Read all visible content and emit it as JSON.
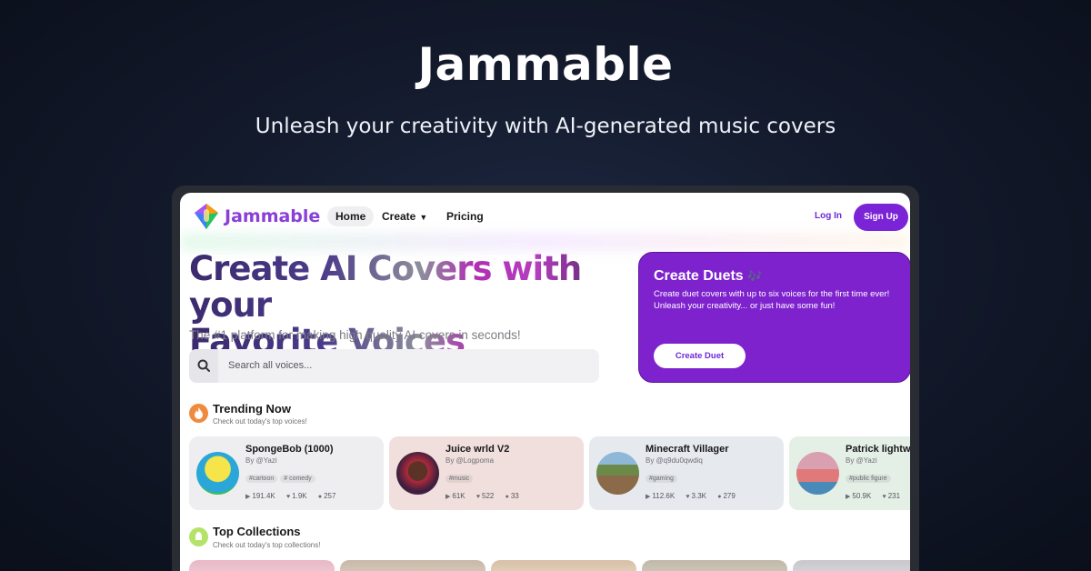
{
  "promo": {
    "title": "Jammable",
    "subtitle": "Unleash your creativity with AI-generated music covers"
  },
  "nav": {
    "logo_text": "Jammable",
    "home": "Home",
    "create": "Create",
    "pricing": "Pricing",
    "login": "Log In",
    "signup": "Sign Up"
  },
  "hero": {
    "headline_line1": "Create AI Covers with your",
    "headline_line2": "Favorite Voices",
    "subheadline": "The #1 platform for making high quality AI covers in seconds!",
    "search_placeholder": "Search all voices..."
  },
  "duet": {
    "title": "Create Duets",
    "notes": "🎶",
    "description": "Create duet covers with up to six voices for the first time ever! Unleash your creativity... or just have some fun!",
    "button": "Create Duet"
  },
  "trending": {
    "title": "Trending Now",
    "subtitle": "Check out today's top voices!",
    "cards": [
      {
        "name": "SpongeBob (1000)",
        "author": "By @Yazi",
        "tags": [
          "#cartoon",
          "# comedy"
        ],
        "plays": "191.4K",
        "likes": "1.9K",
        "comments": "257",
        "bg": "#eeeef1"
      },
      {
        "name": "Juice wrld V2",
        "author": "By @Logpoma",
        "tags": [
          "#music"
        ],
        "plays": "61K",
        "likes": "522",
        "comments": "33",
        "bg": "#f0dfdc"
      },
      {
        "name": "Minecraft Villager",
        "author": "By @q9du0qwdiq",
        "tags": [
          "#gaming"
        ],
        "plays": "112.6K",
        "likes": "3.3K",
        "comments": "279",
        "bg": "#e6e9ee"
      },
      {
        "name": "Patrick lightw",
        "author": "By @Yazi",
        "tags": [
          "#public figure"
        ],
        "plays": "50.9K",
        "likes": "231",
        "comments": "",
        "bg": "#e4efe6"
      }
    ]
  },
  "collections": {
    "title": "Top Collections",
    "subtitle": "Check out today's top collections!"
  },
  "colors": {
    "brand_purple": "#7b23d6",
    "duet_bg": "#7e22ce",
    "trending_icon": "#f08a3c",
    "collections_icon": "#b5e36a"
  }
}
